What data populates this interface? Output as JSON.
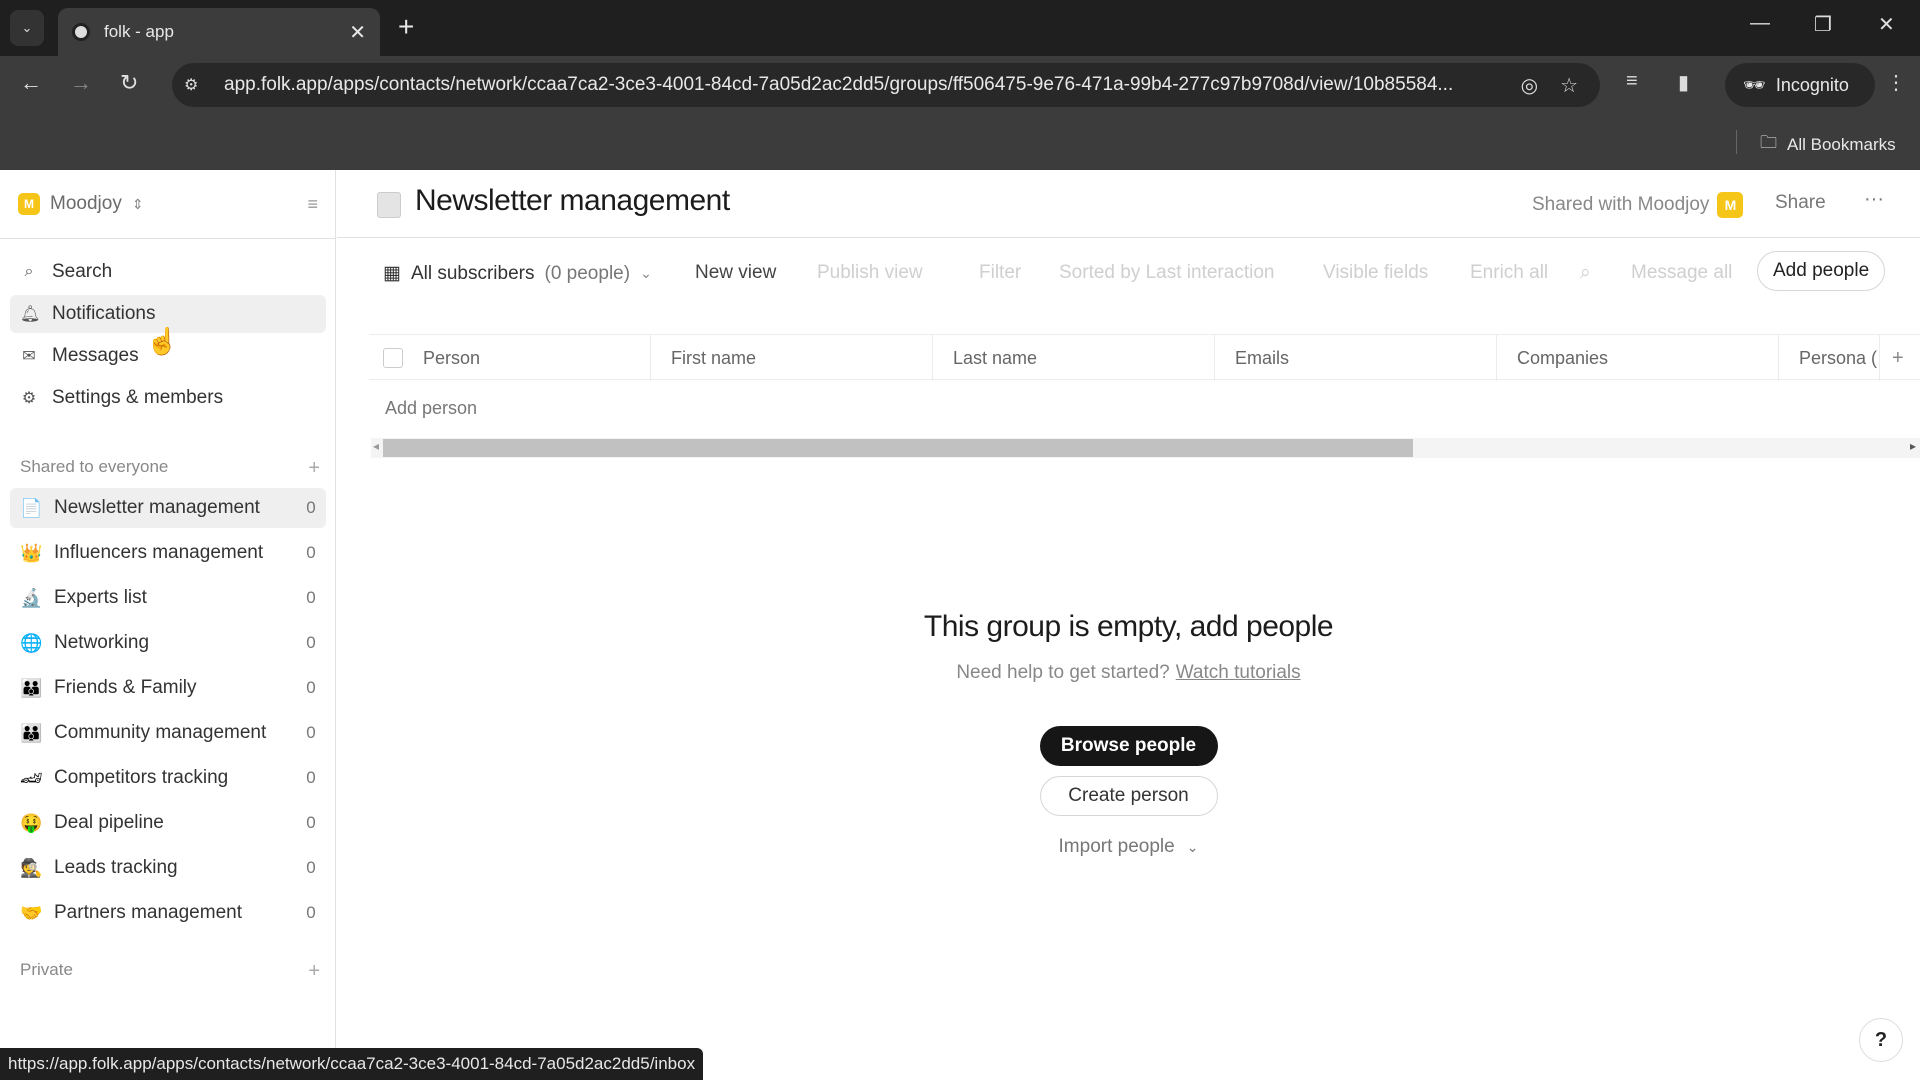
{
  "browser": {
    "tab_title": "folk - app",
    "url": "app.folk.app/apps/contacts/network/ccaa7ca2-3ce3-4001-84cd-7a05d2ac2dd5/groups/ff506475-9e76-471a-99b4-277c97b9708d/view/10b85584...",
    "incognito_label": "Incognito",
    "bookmarks_label": "All Bookmarks",
    "status_url": "https://app.folk.app/apps/contacts/network/ccaa7ca2-3ce3-4001-84cd-7a05d2ac2dd5/inbox"
  },
  "sidebar": {
    "workspace": {
      "badge": "M",
      "name": "Moodjoy"
    },
    "nav": [
      {
        "label": "Search",
        "icon": "search-icon"
      },
      {
        "label": "Notifications",
        "icon": "bell-icon"
      },
      {
        "label": "Messages",
        "icon": "mail-icon"
      },
      {
        "label": "Settings & members",
        "icon": "gear-icon"
      }
    ],
    "shared_section": "Shared to everyone",
    "groups": [
      {
        "emoji": "📄",
        "label": "Newsletter management",
        "count": "0"
      },
      {
        "emoji": "👑",
        "label": "Influencers management",
        "count": "0"
      },
      {
        "emoji": "🔬",
        "label": "Experts list",
        "count": "0"
      },
      {
        "emoji": "🌐",
        "label": "Networking",
        "count": "0"
      },
      {
        "emoji": "👪",
        "label": "Friends & Family",
        "count": "0"
      },
      {
        "emoji": "👪",
        "label": "Community management",
        "count": "0"
      },
      {
        "emoji": "🏎",
        "label": "Competitors tracking",
        "count": "0"
      },
      {
        "emoji": "🤑",
        "label": "Deal pipeline",
        "count": "0"
      },
      {
        "emoji": "🕵",
        "label": "Leads tracking",
        "count": "0"
      },
      {
        "emoji": "🤝",
        "label": "Partners management",
        "count": "0"
      }
    ],
    "private_section": "Private"
  },
  "header": {
    "title": "Newsletter management",
    "shared_with": "Shared with Moodjoy",
    "shared_badge": "M",
    "share_label": "Share",
    "more_label": "···"
  },
  "viewbar": {
    "view_name": "All subscribers",
    "view_count": "(0 people)",
    "new_view": "New view",
    "publish_view": "Publish view",
    "filter": "Filter",
    "sorted": "Sorted by Last interaction",
    "visible_fields": "Visible fields",
    "enrich_all": "Enrich all",
    "message_all": "Message all",
    "add_people": "Add people"
  },
  "table": {
    "columns": [
      "Person",
      "First name",
      "Last name",
      "Emails",
      "Companies",
      "Persona ("
    ],
    "add_person": "Add person"
  },
  "empty_state": {
    "title": "This group is empty, add people",
    "help_text": "Need help to get started?",
    "help_link": "Watch tutorials",
    "browse": "Browse people",
    "create": "Create person",
    "import": "Import people"
  },
  "help_label": "?"
}
